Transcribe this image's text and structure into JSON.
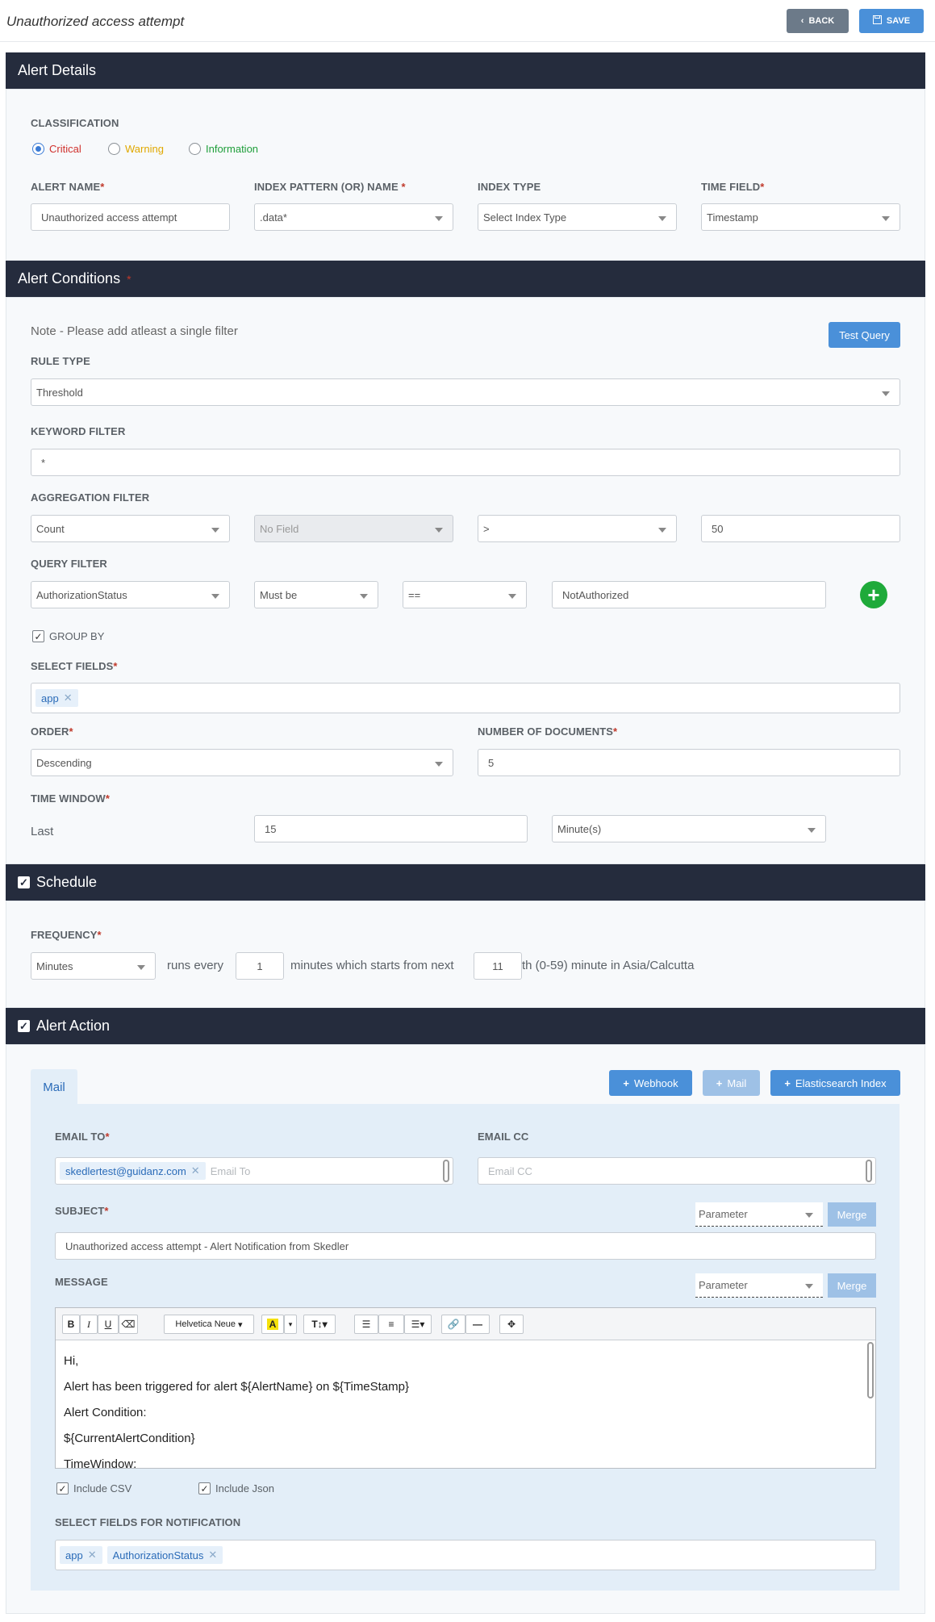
{
  "header": {
    "title": "Unauthorized access attempt",
    "back_label": "BACK",
    "save_label": "SAVE"
  },
  "alert_details": {
    "heading": "Alert Details",
    "classification_label": "CLASSIFICATION",
    "classifications": [
      {
        "label": "Critical",
        "color": "#d0312d",
        "selected": true
      },
      {
        "label": "Warning",
        "color": "#e0a800",
        "selected": false
      },
      {
        "label": "Information",
        "color": "#1e9e3a",
        "selected": false
      }
    ],
    "alert_name_label": "ALERT NAME",
    "alert_name_value": "Unauthorized access attempt",
    "index_pattern_label": "INDEX PATTERN (OR) NAME",
    "index_pattern_value": ".data*",
    "index_type_label": "INDEX TYPE",
    "index_type_value": "Select Index Type",
    "time_field_label": "TIME FIELD",
    "time_field_value": "Timestamp"
  },
  "alert_conditions": {
    "heading": "Alert Conditions",
    "required_mark": "*",
    "note": "Note - Please add atleast a single filter",
    "test_query_label": "Test Query",
    "rule_type_label": "RULE TYPE",
    "rule_type_value": "Threshold",
    "keyword_filter_label": "KEYWORD FILTER",
    "keyword_filter_value": "*",
    "aggregation_filter_label": "AGGREGATION FILTER",
    "aggregation": {
      "function": "Count",
      "field": "No Field",
      "operator": ">",
      "value": "50"
    },
    "query_filter_label": "QUERY FILTER",
    "query": {
      "field": "AuthorizationStatus",
      "condition": "Must be",
      "operator": "==",
      "value": "NotAuthorized"
    },
    "group_by_label": "GROUP BY",
    "select_fields_label": "SELECT FIELDS",
    "select_fields": [
      "app"
    ],
    "order_label": "ORDER",
    "order_value": "Descending",
    "num_docs_label": "NUMBER OF DOCUMENTS",
    "num_docs_value": "5",
    "time_window_label": "TIME WINDOW",
    "time_window_prefix": "Last",
    "time_window_value": "15",
    "time_window_unit": "Minute(s)"
  },
  "schedule": {
    "heading": "Schedule",
    "frequency_label": "FREQUENCY",
    "frequency_value": "Minutes",
    "runs_every_text": "runs  every",
    "every_value": "1",
    "minutes_text": "minutes  which starts from next",
    "start_value": "11",
    "suffix_text": "th (0-59) minute in  Asia/Calcutta"
  },
  "alert_action": {
    "heading": "Alert Action",
    "tab_mail": "Mail",
    "webhook_label": "Webhook",
    "mail_label": "Mail",
    "es_index_label": "Elasticsearch Index",
    "email_to_label": "EMAIL TO",
    "email_to_tags": [
      "skedlertest@guidanz.com"
    ],
    "email_to_placeholder": "Email To",
    "email_cc_label": "EMAIL CC",
    "email_cc_placeholder": "Email CC",
    "subject_label": "SUBJECT",
    "parameter_label": "Parameter",
    "merge_label": "Merge",
    "subject_value": "Unauthorized access attempt - Alert Notification from Skedler",
    "message_label": "MESSAGE",
    "font_name": "Helvetica Neue",
    "message_lines": [
      "Hi,",
      "Alert has been triggered for alert ${AlertName} on ${TimeStamp}",
      "Alert Condition:",
      "${CurrentAlertCondition}",
      "TimeWindow:"
    ],
    "include_csv_label": "Include CSV",
    "include_json_label": "Include Json",
    "notif_fields_label": "SELECT FIELDS FOR NOTIFICATION",
    "notif_fields": [
      "app",
      "AuthorizationStatus"
    ]
  }
}
